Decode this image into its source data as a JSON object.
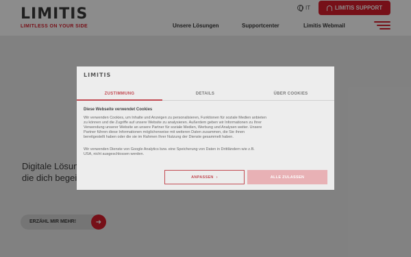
{
  "header": {
    "logo_word": "LIMITIS",
    "logo_tagline": "LIMITLESS ON YOUR SIDE",
    "language": "IT",
    "support_button": "LIMITIS SUPPORT",
    "nav": [
      "Unsere Lösungen",
      "Supportcenter",
      "Limitis Webmail"
    ]
  },
  "hero": {
    "headline_line1": "Digitale Lösungen,",
    "headline_line2": "die dich begeistern werden",
    "cta_label": "ERZÄHL MIR MEHR!"
  },
  "cookie_dialog": {
    "logo": "LIMITIS",
    "tabs": [
      "ZUSTIMMUNG",
      "DETAILS",
      "ÜBER COOKIES"
    ],
    "active_tab": "ZUSTIMMUNG",
    "heading": "Diese Webseite verwendet Cookies",
    "paragraph1_lines": [
      "Wir verwenden Cookies, um Inhalte und Anzeigen zu personalisieren, Funktionen für soziale Medien anbieten",
      "zu können und die Zugriffe auf unsere Website zu analysieren. Außerdem geben wir Informationen zu Ihrer",
      "Verwendung unserer Website an unsere Partner für soziale Medien, Werbung und Analysen weiter. Unsere",
      "Partner führen diese Informationen möglicherweise mit weiteren Daten zusammen, die Sie ihnen",
      "bereitgestellt haben oder die sie im Rahmen Ihrer Nutzung der Dienste gesammelt haben."
    ],
    "paragraph2_lines": [
      "Wir verwenden Dienste von Google Analytics bzw. eine Speicherung von Daten in Drittländern wie z.B.",
      "USA, nicht ausgeschlossen werden."
    ],
    "configure_button": "ANPASSEN",
    "configure_icon": "chevron-right-icon",
    "accept_button": "ALLE ZULASSEN"
  },
  "colors": {
    "brand_red": "#d81e2c",
    "text_dark": "#3a3a3a"
  }
}
